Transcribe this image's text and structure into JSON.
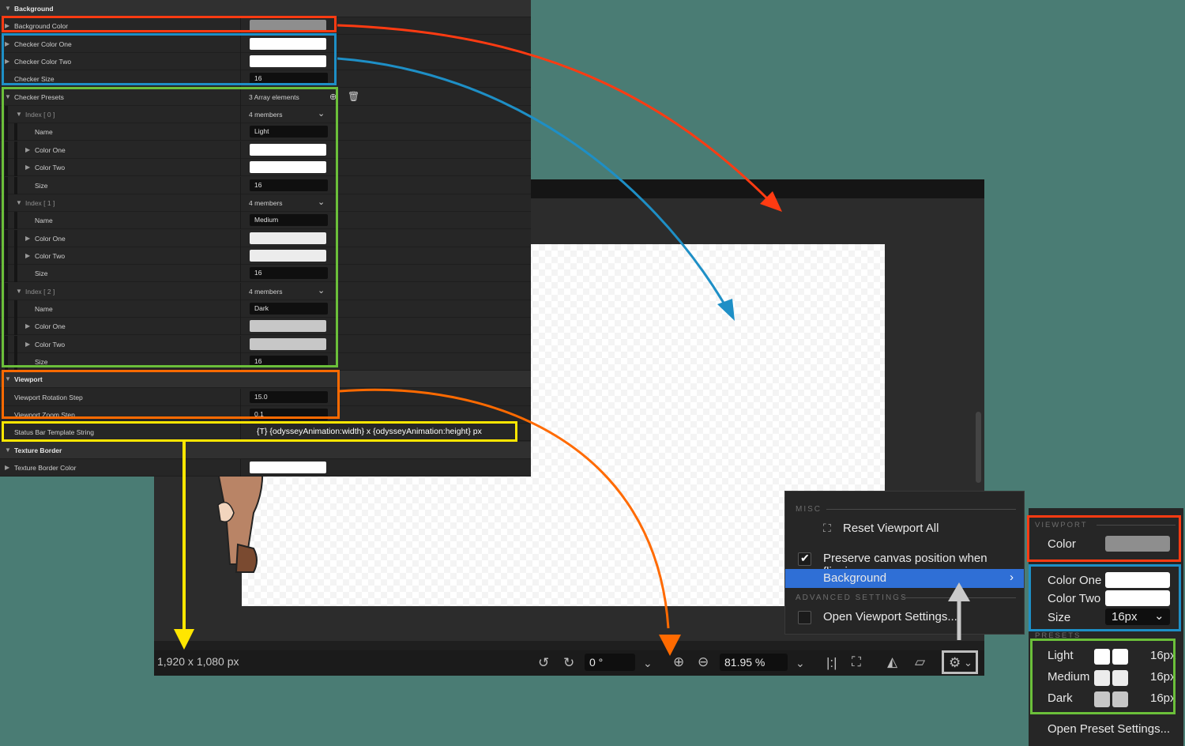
{
  "properties": {
    "background_header": "Background",
    "background_color_label": "Background Color",
    "checker_color_one_label": "Checker Color One",
    "checker_color_two_label": "Checker Color Two",
    "checker_size_label": "Checker Size",
    "checker_size_value": "16",
    "checker_presets_label": "Checker Presets",
    "checker_presets_value": "3 Array elements",
    "presets": [
      {
        "index_label": "Index [ 0 ]",
        "members": "4 members",
        "name_label": "Name",
        "name_value": "Light",
        "color_one_label": "Color One",
        "color_two_label": "Color Two",
        "size_label": "Size",
        "size_value": "16",
        "color_one": "#ffffff",
        "color_two": "#ffffff"
      },
      {
        "index_label": "Index [ 1 ]",
        "members": "4 members",
        "name_label": "Name",
        "name_value": "Medium",
        "color_one_label": "Color One",
        "color_two_label": "Color Two",
        "size_label": "Size",
        "size_value": "16",
        "color_one": "#ececec",
        "color_two": "#ececec"
      },
      {
        "index_label": "Index [ 2 ]",
        "members": "4 members",
        "name_label": "Name",
        "name_value": "Dark",
        "color_one_label": "Color One",
        "color_two_label": "Color Two",
        "size_label": "Size",
        "size_value": "16",
        "color_one": "#c7c7c7",
        "color_two": "#c7c7c7"
      }
    ],
    "viewport_header": "Viewport",
    "rotation_step_label": "Viewport Rotation Step",
    "rotation_step_value": "15.0",
    "zoom_step_label": "Viewport Zoom Step",
    "zoom_step_value": "0.1",
    "status_template_label": "Status Bar Template String",
    "status_template_value": "{T} {odysseyAnimation:width} x {odysseyAnimation:height} px",
    "texture_border_header": "Texture Border",
    "texture_border_color_label": "Texture Border Color"
  },
  "statusbar": {
    "dimensions": "1,920 x 1,080 px",
    "rotation_value": "0 °",
    "zoom_value": "81.95 %"
  },
  "menu": {
    "misc_section": "MISC",
    "reset_viewport": "Reset Viewport All",
    "preserve_canvas": "Preserve canvas position when flipping",
    "background": "Background",
    "advanced_section": "ADVANCED SETTINGS",
    "open_viewport_settings": "Open Viewport Settings..."
  },
  "submenu": {
    "viewport_section": "VIEWPORT",
    "color_label": "Color",
    "color_one_label": "Color One",
    "color_two_label": "Color Two",
    "size_label": "Size",
    "size_value": "16px",
    "presets_section": "PRESETS",
    "presets": [
      {
        "name": "Light",
        "size": "16px",
        "c1": "#ffffff",
        "c2": "#ffffff"
      },
      {
        "name": "Medium",
        "size": "16px",
        "c1": "#ececec",
        "c2": "#ececec"
      },
      {
        "name": "Dark",
        "size": "16px",
        "c1": "#c7c7c7",
        "c2": "#c7c7c7"
      }
    ],
    "open_preset_settings": "Open Preset Settings..."
  },
  "colors": {
    "accent_red": "#ff3b12",
    "accent_blue": "#1e8fc6",
    "accent_green": "#6bbf3a",
    "accent_orange": "#ff6a00",
    "accent_yellow": "#ffe600",
    "menu_highlight": "#2f6fd6",
    "background_swatch": "#8e8e8e"
  }
}
